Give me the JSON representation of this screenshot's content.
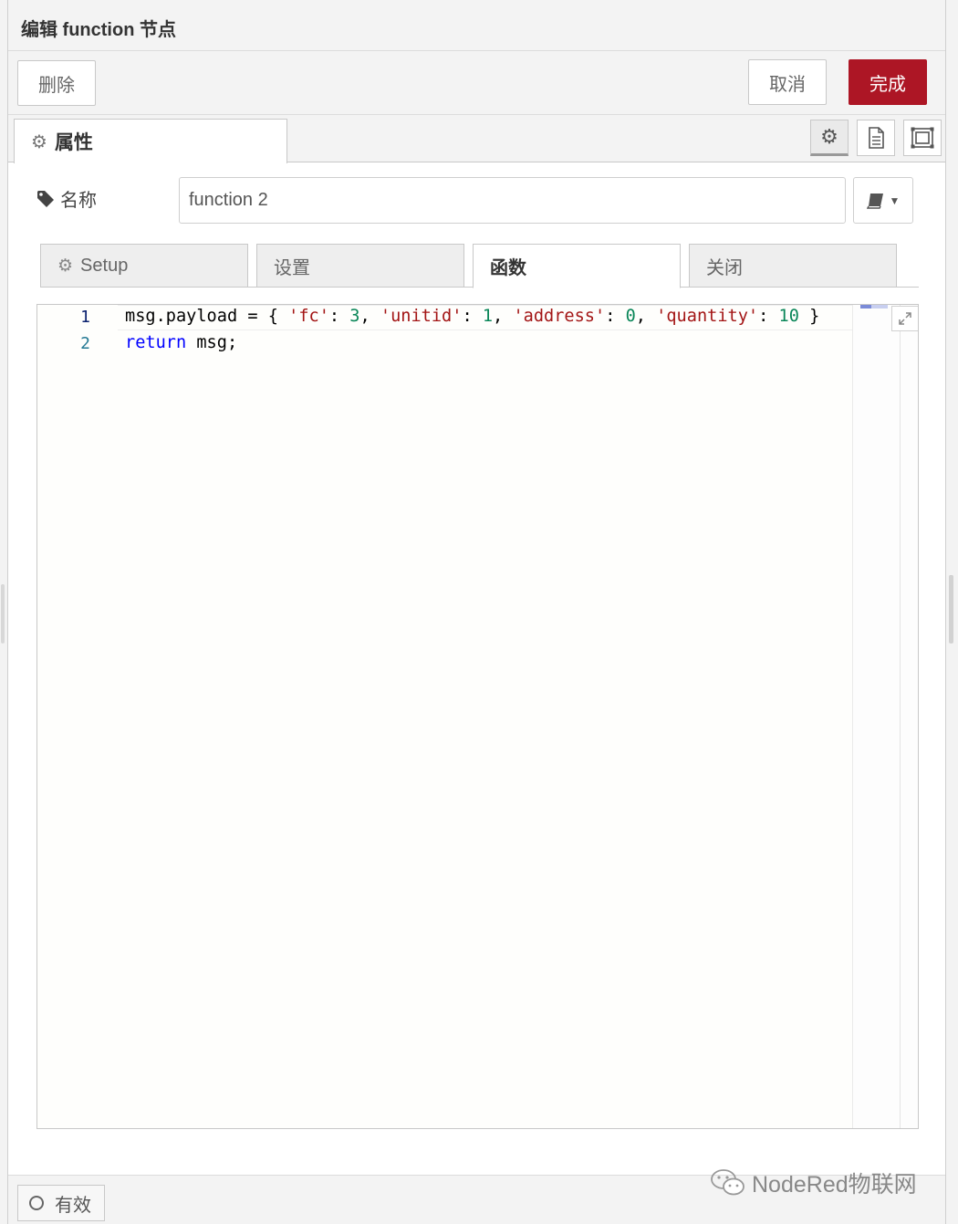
{
  "header": {
    "title": "编辑 function 节点"
  },
  "toolbar": {
    "delete_label": "删除",
    "cancel_label": "取消",
    "done_label": "完成",
    "done_color": "#ad1625"
  },
  "tabs": {
    "properties_label": "属性",
    "icons": [
      "gear-icon",
      "document-icon",
      "frame-icon"
    ]
  },
  "form": {
    "name_label": "名称",
    "name_value": "function 2"
  },
  "subtabs": [
    {
      "label": "Setup"
    },
    {
      "label": "设置"
    },
    {
      "label": "函数"
    },
    {
      "label": "关闭"
    }
  ],
  "editor": {
    "line_numbers": [
      "1",
      "2"
    ],
    "line1": {
      "t0": "msg.payload = { ",
      "s1": "'fc'",
      "t1": ": ",
      "n1": "3",
      "t2": ", ",
      "s2": "'unitid'",
      "t3": ": ",
      "n2": "1",
      "t4": ", ",
      "s3": "'address'",
      "t5": ": ",
      "n3": "0",
      "t6": ", ",
      "s4": "'quantity'",
      "t7": ": ",
      "n4": "10",
      "t8": " }"
    },
    "line2": {
      "kw": "return",
      "rest": " msg;"
    }
  },
  "footer": {
    "enabled_label": "有效"
  },
  "watermark": {
    "text": "NodeRed物联网"
  }
}
